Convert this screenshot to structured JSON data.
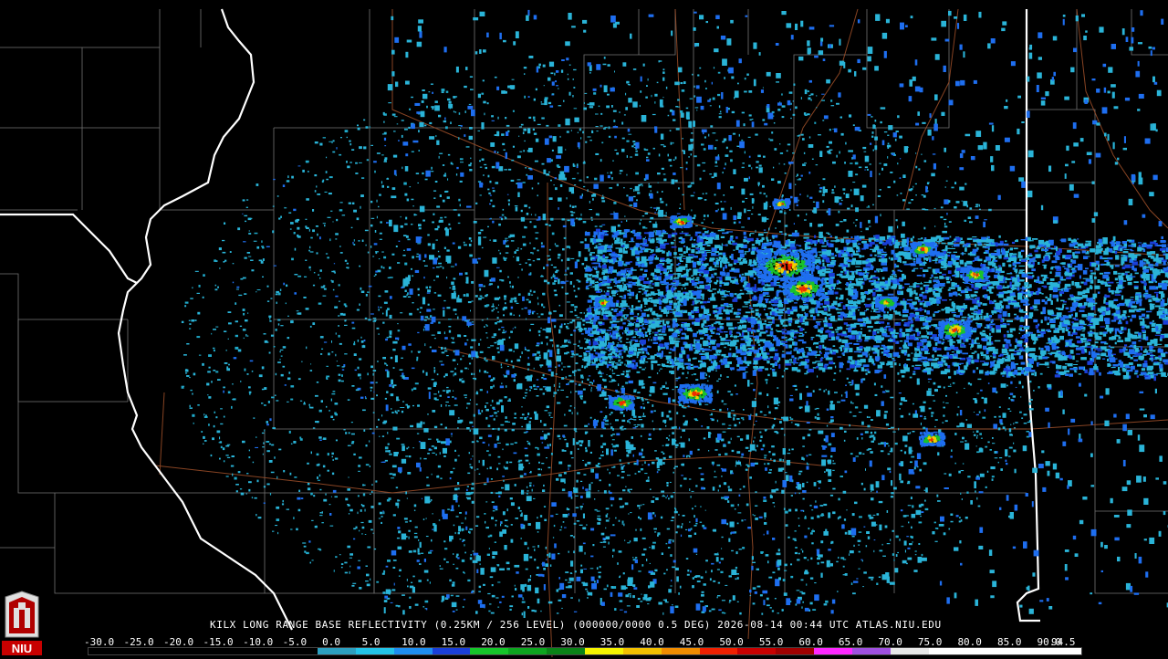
{
  "caption": "KILX LONG RANGE BASE REFLECTIVITY (0.25KM / 256 LEVEL) (000000/0000 0.5 DEG) 2026-08-14 00:44 UTC  ATLAS.NIU.EDU",
  "logo_text": "NIU",
  "scale": {
    "labels": [
      "-30.0",
      "-25.0",
      "-20.0",
      "-15.0",
      "-10.0",
      "-5.0",
      "0.0",
      "5.0",
      "10.0",
      "15.0",
      "20.0",
      "25.0",
      "30.0",
      "35.0",
      "40.0",
      "45.0",
      "50.0",
      "55.0",
      "60.0",
      "65.0",
      "70.0",
      "75.0",
      "80.0",
      "85.0",
      "90.0",
      "94.5"
    ],
    "colors": [
      "#000000",
      "#000000",
      "#000000",
      "#000000",
      "#000000",
      "#000000",
      "#2c9fbf",
      "#23c3e8",
      "#1e8ef0",
      "#1a3fd8",
      "#15c62a",
      "#0da51f",
      "#0a8317",
      "#f5f300",
      "#f2c000",
      "#f08c00",
      "#f02000",
      "#c80000",
      "#a00000",
      "#ff28ff",
      "#a050e0",
      "#e8e8e8",
      "#ffffff",
      "#ffffff",
      "#ffffff",
      "#ffffff"
    ]
  },
  "colors": {
    "state_border": "#ffffff",
    "county_border": "#a0a0a0",
    "road": "#a0502a",
    "weak_echo": "#2ab4d8",
    "moderate_echo": "#1e6ef0",
    "strong_echo": "#19c22a",
    "heavy_echo": "#f2d000",
    "extreme_echo": "#f02a00"
  }
}
